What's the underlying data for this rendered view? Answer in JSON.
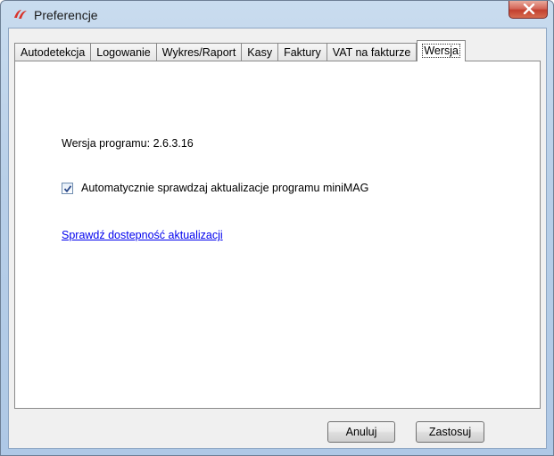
{
  "window": {
    "title": "Preferencje",
    "app_icon": "minimag-logo-icon",
    "close_icon": "close-icon"
  },
  "tabs": [
    {
      "label": "Autodetekcja",
      "active": false
    },
    {
      "label": "Logowanie",
      "active": false
    },
    {
      "label": "Wykres/Raport",
      "active": false
    },
    {
      "label": "Kasy",
      "active": false
    },
    {
      "label": "Faktury",
      "active": false
    },
    {
      "label": "VAT na fakturze",
      "active": false
    },
    {
      "label": "Wersja",
      "active": true
    }
  ],
  "panel": {
    "version_text": "Wersja programu: 2.6.3.16",
    "auto_update_label": "Automatycznie sprawdzaj aktualizacje programu miniMAG",
    "auto_update_checked": true,
    "check_updates_link": "Sprawdź dostepność aktualizacji"
  },
  "buttons": {
    "cancel": "Anuluj",
    "apply": "Zastosuj"
  },
  "colors": {
    "link": "#0000ee",
    "close_button": "#c3402f"
  }
}
